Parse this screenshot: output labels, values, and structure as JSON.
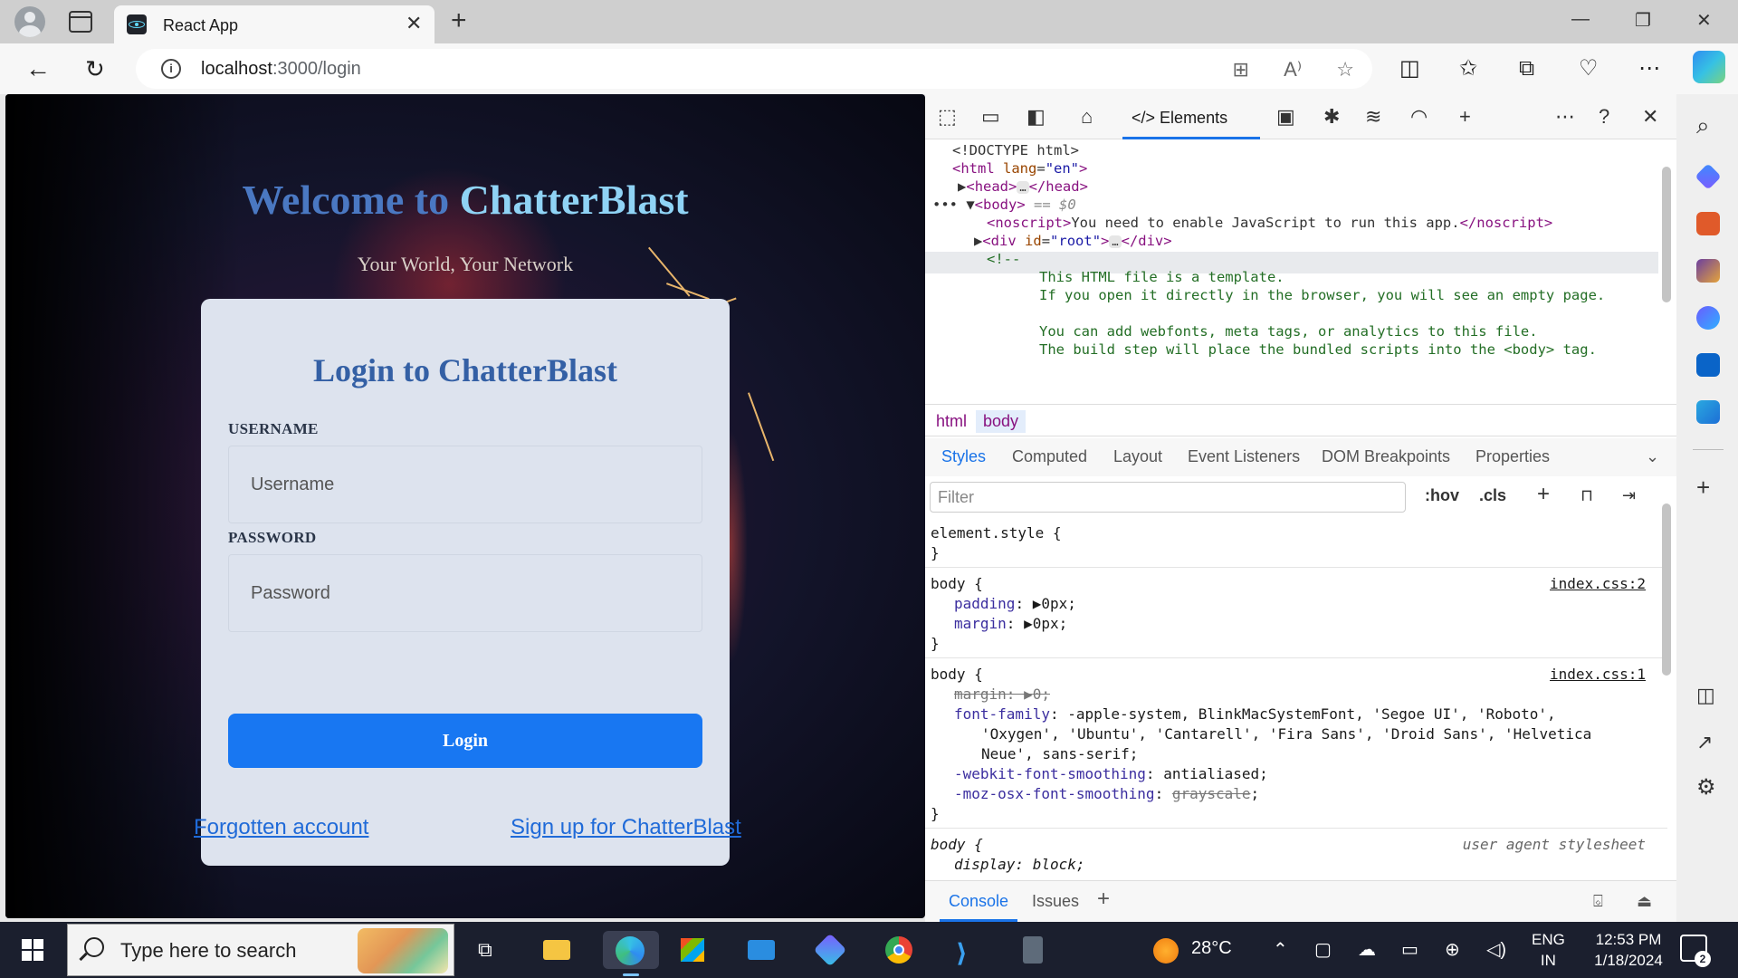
{
  "browser": {
    "tab_title": "React App",
    "url_host": "localhost",
    "url_path": ":3000/login"
  },
  "page": {
    "welcome_prefix": "Welcome to",
    "welcome_brand": "ChatterBlast",
    "tagline": "Your World, Your Network",
    "login_title": "Login to ChatterBlast",
    "username_label": "USERNAME",
    "username_placeholder": "Username",
    "password_label": "PASSWORD",
    "password_placeholder": "Password",
    "login_button": "Login",
    "forgot_link": "Forgotten account",
    "signup_link": "Sign up for ChatterBlast"
  },
  "devtools": {
    "active_tab": "Elements",
    "dom": {
      "doctype": "<!DOCTYPE html>",
      "html_open": "html",
      "lang_attr": "lang",
      "lang_val": "\"en\"",
      "head_tag": "head",
      "body_tag": "body",
      "selected_marker": "== $0",
      "noscript_text": "You need to enable JavaScript to run this app.",
      "div_id_val": "\"root\"",
      "comment_open": "<!--",
      "comment_1": "This HTML file is a template.",
      "comment_2": "If you open it directly in the browser, you will see an empty page.",
      "comment_3": "You can add webfonts, meta tags, or analytics to this file.",
      "comment_4": "The build step will place the bundled scripts into the <body> tag."
    },
    "breadcrumbs": [
      "html",
      "body"
    ],
    "sub_tabs": [
      "Styles",
      "Computed",
      "Layout",
      "Event Listeners",
      "DOM Breakpoints",
      "Properties"
    ],
    "filter_placeholder": "Filter",
    "filter_hov": ":hov",
    "filter_cls": ".cls",
    "styles": {
      "element_style": "element.style {",
      "close_brace": "}",
      "rule1_selector": "body {",
      "rule1_source": "index.css:2",
      "rule1_props": [
        {
          "name": "padding",
          "value": "0px;"
        },
        {
          "name": "margin",
          "value": "0px;"
        }
      ],
      "rule2_selector": "body {",
      "rule2_source": "index.css:1",
      "rule2_margin": "0;",
      "rule2_font_family_name": "font-family",
      "rule2_font_family_l1": "-apple-system, BlinkMacSystemFont, 'Segoe UI', 'Roboto',",
      "rule2_font_family_l2": "'Oxygen', 'Ubuntu', 'Cantarell', 'Fira Sans', 'Droid Sans', 'Helvetica",
      "rule2_font_family_l3": "Neue', sans-serif;",
      "rule2_smoothing_webkit_name": "-webkit-font-smoothing",
      "rule2_smoothing_webkit_val": "antialiased;",
      "rule2_smoothing_moz_name": "-moz-osx-font-smoothing",
      "rule2_smoothing_moz_val": "grayscale",
      "rule3_selector": "body {",
      "rule3_source": "user agent stylesheet",
      "rule3_prop": "display: block;"
    },
    "drawer_tabs": [
      "Console",
      "Issues"
    ]
  },
  "taskbar": {
    "search_placeholder": "Type here to search",
    "weather": "28°C",
    "lang_line1": "ENG",
    "lang_line2": "IN",
    "time": "12:53 PM",
    "date": "1/18/2024",
    "notif_count": "2"
  },
  "colors": {
    "accent": "#1877f2",
    "devtools_accent": "#1a73e8",
    "card_bg": "#dde3ee",
    "brand_blue": "#3460a5"
  }
}
